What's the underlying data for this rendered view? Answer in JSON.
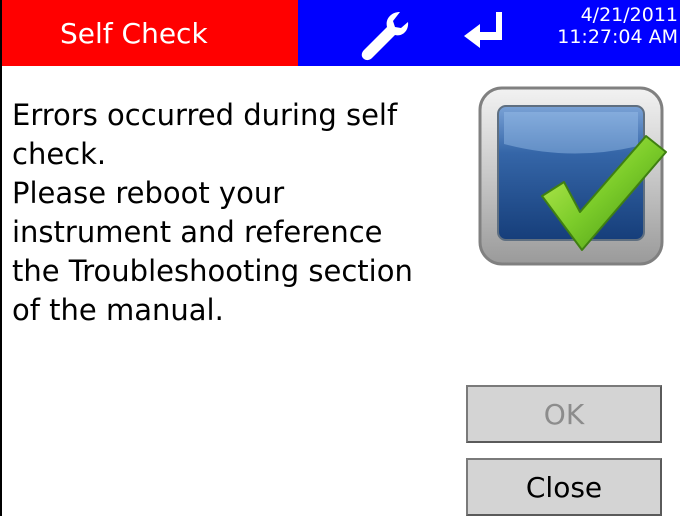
{
  "title_bar": {
    "title": "Self Check",
    "date": "4/21/2011",
    "time": "11:27:04 AM",
    "title_bg_color": "#ff0000",
    "status_bg_color": "#0000ff",
    "icons": [
      "wrench-icon",
      "enter-return-icon"
    ]
  },
  "message": {
    "lines": [
      "Errors occurred during self",
      "check.",
      "Please reboot your",
      "instrument and reference",
      "the Troubleshooting section",
      "of the manual."
    ]
  },
  "status_image": {
    "icon": "monitor-checkmark-icon",
    "check_color": "#7ccc2a"
  },
  "buttons": {
    "ok_label": "OK",
    "ok_state": "disabled",
    "close_label": "Close"
  }
}
